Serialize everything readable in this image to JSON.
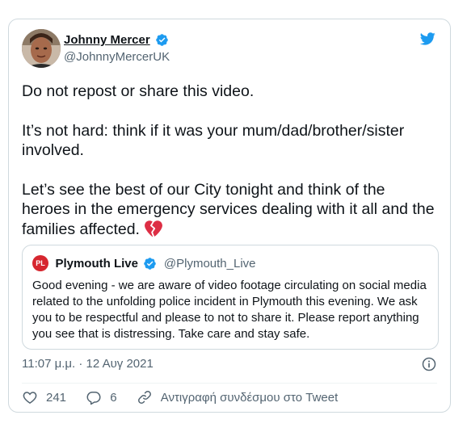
{
  "author": {
    "display_name": "Johnny Mercer",
    "handle": "@JohnnyMercerUK",
    "verified": true
  },
  "tweet": {
    "paragraphs": [
      "Do not repost or share this video.",
      "It’s not hard: think if it was your mum/dad/brother/sister involved.",
      "Let’s see the best of our City tonight and think of the heroes in the emergency services dealing with it all and the families affected."
    ],
    "emoji": "broken-heart-emoji"
  },
  "quoted": {
    "avatar_text": "PL",
    "display_name": "Plymouth Live",
    "handle": "@Plymouth_Live",
    "text": "Good evening - we are aware of video footage circulating on social media related to the unfolding police incident in Plymouth this evening. We ask you to be respectful and please to not to share it. Please report anything you see that is distressing. Take care and stay safe."
  },
  "timestamp": "11:07 μ.μ. · 12 Αυγ 2021",
  "actions": {
    "likes": "241",
    "replies": "6",
    "copy_link_label": "Αντιγραφή συνδέσμου στο Tweet"
  },
  "colors": {
    "twitter_blue": "#1d9bf0",
    "secondary_text": "#536471",
    "border": "#cfd9de",
    "plymouth_red": "#d6262f",
    "broken_heart": "#dd2e44"
  },
  "icons": [
    "twitter-bird-icon",
    "verified-badge-icon",
    "info-icon",
    "heart-icon",
    "reply-icon",
    "link-icon",
    "broken-heart-emoji"
  ]
}
